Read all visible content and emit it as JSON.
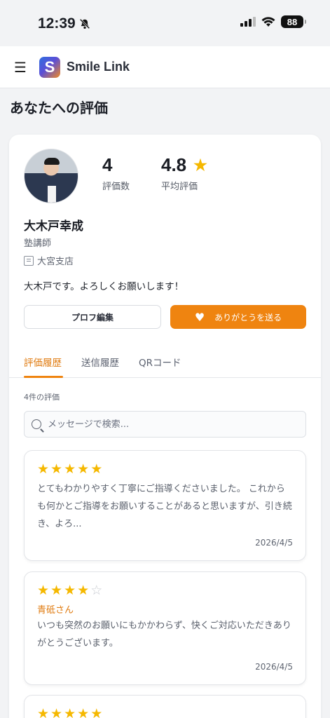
{
  "status_bar": {
    "time": "12:39",
    "battery": "88"
  },
  "header": {
    "app_name": "Smile Link",
    "logo_letter": "S"
  },
  "page_title": "あなたへの評価",
  "profile": {
    "review_count": "4",
    "review_count_label": "評価数",
    "average_rating": "4.8",
    "average_rating_label": "平均評価",
    "name": "大木戸幸成",
    "role": "塾講師",
    "branch": "大宮支店",
    "bio": "大木戸です。よろしくお願いします！",
    "edit_button": "プロフ編集",
    "thanks_button": "ありがとうを送る"
  },
  "tabs": [
    {
      "label": "評価履歴",
      "active": true
    },
    {
      "label": "送信履歴",
      "active": false
    },
    {
      "label": "QRコード",
      "active": false
    }
  ],
  "count_label": "4件の評価",
  "search": {
    "placeholder": "メッセージで検索...",
    "value": ""
  },
  "reviews": [
    {
      "rating": 5,
      "reviewer": "",
      "text": "とてもわかりやすく丁寧にご指導くださいました。 これからも何かとご指導をお願いすることがあると思いますが、引き続き、よろ...",
      "date": "2026/4/5"
    },
    {
      "rating": 4,
      "reviewer": "青砥さん",
      "text": "いつも突然のお願いにもかかわらず、快くご対応いただきありがとうございます。",
      "date": "2026/4/5"
    },
    {
      "rating": 5,
      "reviewer": "",
      "text": "",
      "date": ""
    }
  ],
  "colors": {
    "accent": "#ef8410",
    "star": "#f5b800"
  }
}
